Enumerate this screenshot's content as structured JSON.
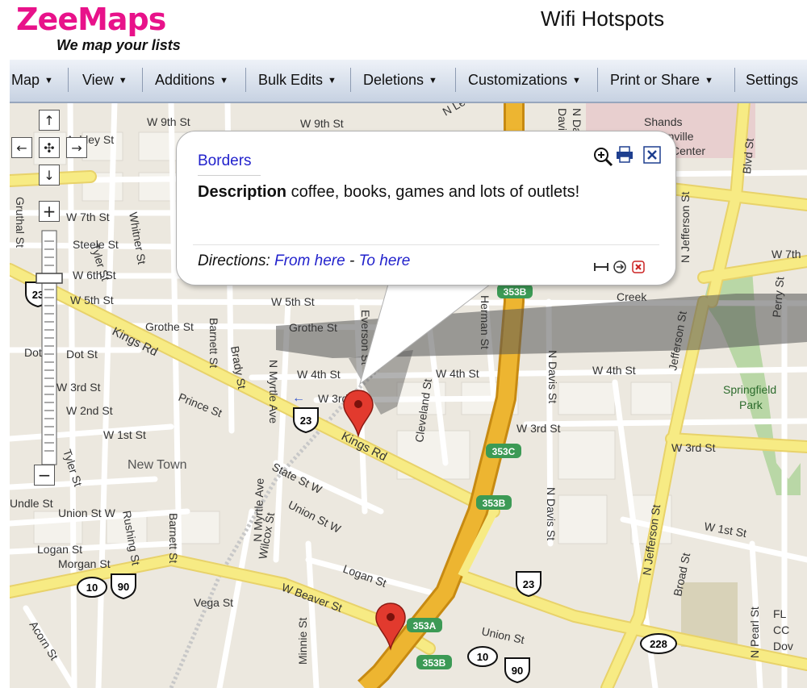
{
  "header": {
    "logo_text": "ZeeMaps",
    "tagline": "We map your lists",
    "page_title": "Wifi Hotspots",
    "brand_color": "#e8128a"
  },
  "menubar": {
    "items": [
      {
        "label": "Map"
      },
      {
        "label": "View"
      },
      {
        "label": "Additions"
      },
      {
        "label": "Bulk Edits"
      },
      {
        "label": "Deletions"
      },
      {
        "label": "Customizations"
      },
      {
        "label": "Print or Share"
      },
      {
        "label": "Settings"
      }
    ]
  },
  "map_controls": {
    "pan_up": "↑",
    "pan_left": "←",
    "pan_center": "✣",
    "pan_right": "→",
    "pan_down": "↓",
    "zoom_in": "+",
    "zoom_out": "−"
  },
  "popup": {
    "title": "Borders",
    "description_label": "Description",
    "description_text": "coffee, books, games and lots of outlets!",
    "directions_label": "Directions:",
    "from_here": "From here",
    "separator": "-",
    "to_here": "To here",
    "icons": [
      "zoom-in-icon",
      "print-icon",
      "close-icon",
      "resize-icon",
      "forward-icon",
      "delete-icon"
    ]
  },
  "map_labels": {
    "streets": [
      "W 9th St",
      "W 9th St",
      "Ashley St",
      "W 7th St",
      "Steele St",
      "W 6th St",
      "W 5th St",
      "W 5th St",
      "Grothe St",
      "Grothe St",
      "Kings Rd",
      "Kings Rd",
      "W 4th St",
      "W 4th St",
      "W 4th St",
      "W 3rd",
      "W 3rd St",
      "W 3rd St",
      "W 3rd St",
      "W 2nd St",
      "W 1st St",
      "W 1st St",
      "Prince St",
      "State St W",
      "Union St W",
      "Union St W",
      "Union St",
      "Logan St",
      "Logan St",
      "Morgan St",
      "W Beaver St",
      "Vega St",
      "Acorn St",
      "Minnie St",
      "Wilcox St",
      "N Myrtle Ave",
      "N Myrtle Ave",
      "Rushing St",
      "Barnett St",
      "Barnett St",
      "Tyler St",
      "Tyler St",
      "Whitner St",
      "Gruthal St",
      "Brady St",
      "Everson St",
      "Cleveland St",
      "Herman St",
      "N Davis St",
      "N Davis St",
      "N Davis St",
      "N Jefferson St",
      "N Jefferson St",
      "Jefferson St",
      "Broad St",
      "Blvd St",
      "N Pearl St",
      "Perry St",
      "W 7th",
      "Dot St",
      "Dot St",
      "Undle St",
      "Creek",
      "Shands",
      "Jacksonville",
      "Center",
      "Springfield",
      "Park",
      "FL",
      "CC",
      "Dov",
      "New Town",
      "N Lee St",
      "Davis St"
    ],
    "shields": [
      "23",
      "23",
      "23",
      "90",
      "90",
      "10",
      "10",
      "228",
      "353B",
      "353C",
      "353B",
      "353A",
      "353B"
    ]
  },
  "colors": {
    "map_bg": "#ece8df",
    "road": "#f7eb84",
    "highway": "#edb531",
    "park": "#b9d7a6",
    "hospital": "#e8cfcf",
    "link": "#2222cc",
    "menu_bg": "#dde4ef"
  }
}
